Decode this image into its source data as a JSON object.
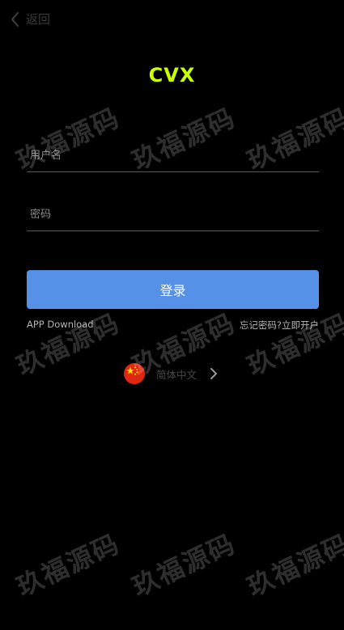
{
  "header": {
    "back_label": "返回"
  },
  "logo": {
    "text": "CVX",
    "color": "#c9ff00"
  },
  "form": {
    "username_placeholder": "用户名",
    "password_placeholder": "密码",
    "login_label": "登录",
    "login_button_color": "#5591e6"
  },
  "links": {
    "app_download": "APP Download",
    "forgot_password": "忘记密码?",
    "open_account": "立即开户"
  },
  "language": {
    "flag_icon": "china-flag-icon",
    "label": "简体中文"
  },
  "watermark": {
    "text": "玖福源码"
  }
}
